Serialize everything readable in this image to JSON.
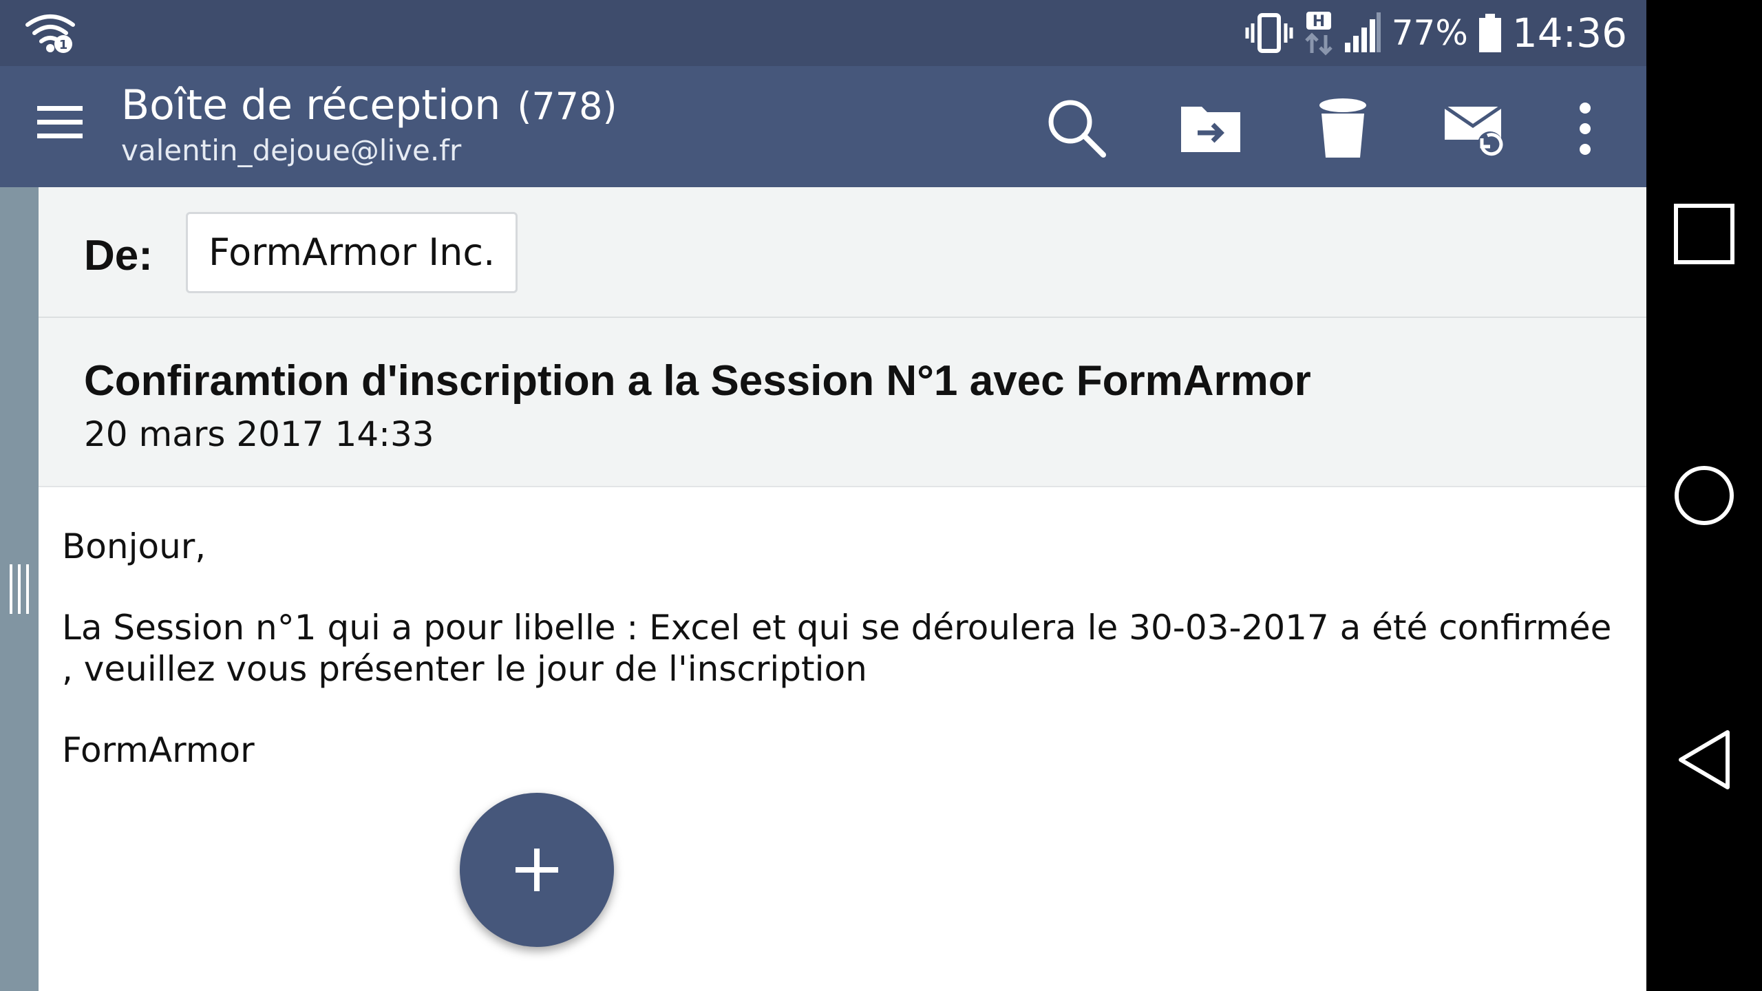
{
  "status_bar": {
    "battery_percent": "77%",
    "time": "14:36",
    "icons": [
      "wifi-icon",
      "vibrate-icon",
      "hplus-data-icon",
      "signal-icon",
      "battery-icon"
    ]
  },
  "app_bar": {
    "folder_title": "Boîte de réception",
    "unread_count": "(778)",
    "account_email": "valentin_dejoue@live.fr",
    "actions": [
      "menu-icon",
      "search-icon",
      "move-folder-icon",
      "delete-icon",
      "mark-unread-icon",
      "overflow-icon"
    ]
  },
  "message": {
    "from_label": "De:",
    "sender": "FormArmor Inc.",
    "subject": "Confiramtion d'inscription a la Session N°1 avec FormArmor",
    "date": "20 mars 2017 14:33",
    "body": {
      "greeting": "Bonjour,",
      "paragraph": "La Session n°1 qui a pour libelle : Excel et qui se déroulera le 30-03-2017 a été confirmée , veuillez vous présenter le jour de l'inscription",
      "signature": "FormArmor"
    }
  },
  "fab": {
    "icon": "plus-icon"
  },
  "navigation_bar": {
    "icons": [
      "recents-icon",
      "home-icon",
      "back-icon"
    ]
  },
  "colors": {
    "status_bar": "#3e4c6c",
    "app_bar": "#46577b",
    "drawer_handle": "#8195a2",
    "header_background": "#f2f4f4"
  }
}
